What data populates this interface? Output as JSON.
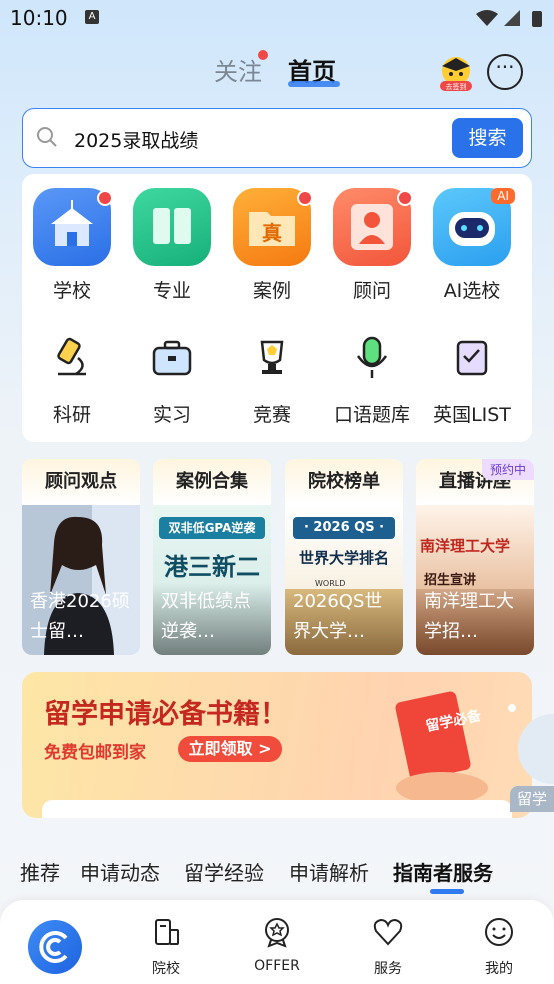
{
  "status_bar": {
    "time": "10:10",
    "notif_letter": "A"
  },
  "header": {
    "tab_follow": "关注",
    "tab_home": "首页",
    "checkin_label": "去签到"
  },
  "search": {
    "query": "2025录取战绩",
    "button_label": "搜索"
  },
  "main_grid": [
    {
      "label": "学校",
      "color": "#3d7cf0",
      "dot": true
    },
    {
      "label": "专业",
      "color": "#25c08a",
      "dot": false
    },
    {
      "label": "案例",
      "color": "#f7931e",
      "dot": true,
      "glyph": "真"
    },
    {
      "label": "顾问",
      "color": "#f86d4f",
      "dot": true
    },
    {
      "label": "AI选校",
      "color": "#3ab0f5",
      "dot": false,
      "badge": "AI"
    }
  ],
  "tool_grid": [
    {
      "label": "科研"
    },
    {
      "label": "实习"
    },
    {
      "label": "竞赛"
    },
    {
      "label": "口语题库"
    },
    {
      "label": "英国LIST"
    }
  ],
  "cards": [
    {
      "title": "顾问观点",
      "caption": "香港2026硕士留…"
    },
    {
      "title": "案例合集",
      "caption": "双非低绩点逆袭…",
      "img_line1": "双非低GPA逆袭",
      "img_line2": "港三新二"
    },
    {
      "title": "院校榜单",
      "caption": "2026QS世界大学…",
      "img_line1": "· 2026 QS ·",
      "img_line2": "世界大学排名",
      "img_line3": "WORLD"
    },
    {
      "title": "直播讲座",
      "caption": "南洋理工大学招…",
      "badge": "预约中",
      "img_line1": "南洋理工大学",
      "img_line2": "招生宣讲"
    }
  ],
  "banner": {
    "title": "留学申请必备书籍！",
    "subtitle": "免费包邮到家",
    "cta": "立即领取 >",
    "book_text": "留学必备",
    "side_text": "留学"
  },
  "category_tabs": [
    "推荐",
    "申请动态",
    "留学经验",
    "申请解析",
    "指南者服务"
  ],
  "bottom_nav": [
    {
      "label": ""
    },
    {
      "label": "院校"
    },
    {
      "label": "OFFER"
    },
    {
      "label": "服务"
    },
    {
      "label": "我的"
    }
  ],
  "colors": {
    "accent": "#2a72ea",
    "alert": "#f04848"
  }
}
